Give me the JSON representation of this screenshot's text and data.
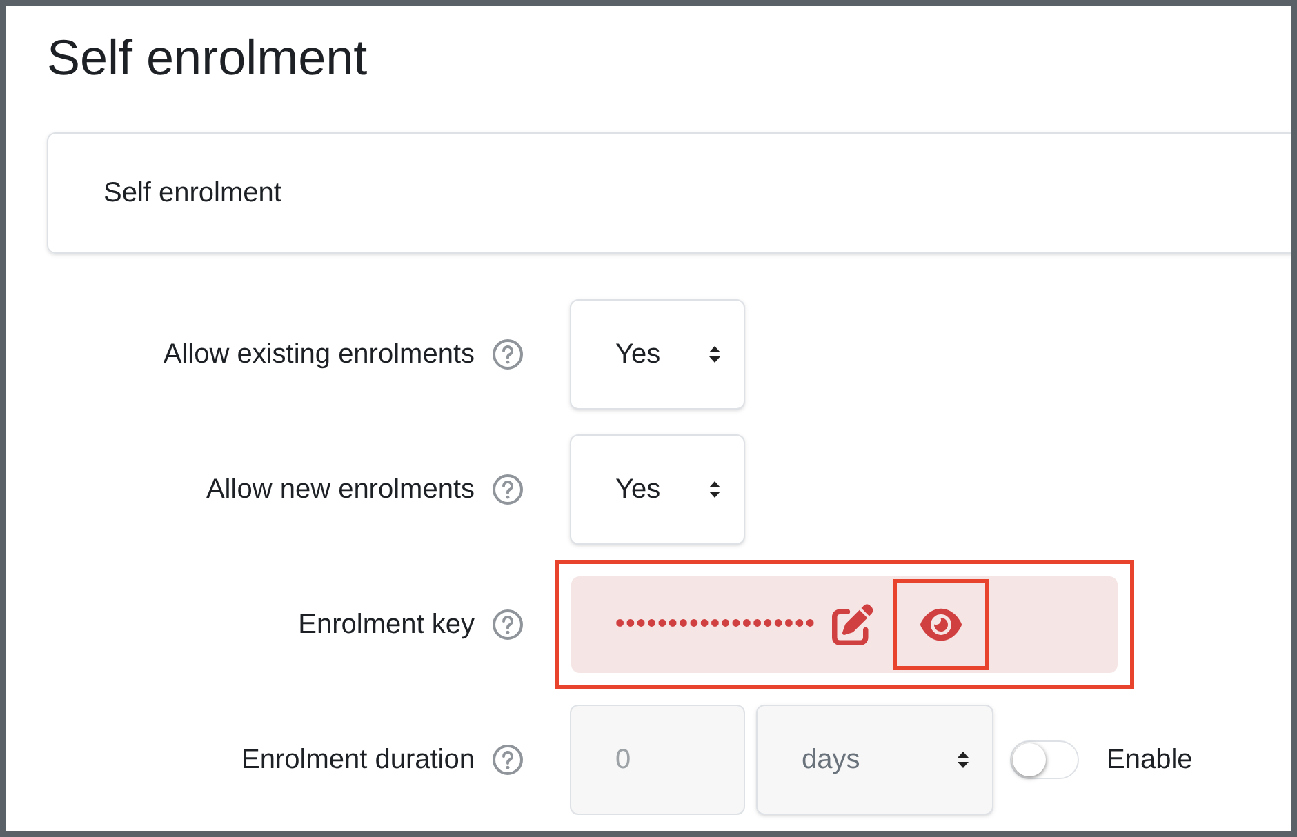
{
  "heading": "Self enrolment",
  "section": {
    "title": "Self enrolment"
  },
  "rows": [
    {
      "kind": "select",
      "label": "Allow existing enrolments",
      "value": "Yes"
    },
    {
      "kind": "select",
      "label": "Allow new enrolments",
      "value": "Yes"
    },
    {
      "kind": "password",
      "label": "Enrolment key",
      "value": "•••••••••••••••••••",
      "highlighted": true,
      "reveal_highlighted": true
    },
    {
      "kind": "duration",
      "label": "Enrolment duration",
      "value": "0",
      "unit": "days",
      "disabled": true,
      "toggle": {
        "label": "Enable",
        "on": false
      }
    }
  ]
}
